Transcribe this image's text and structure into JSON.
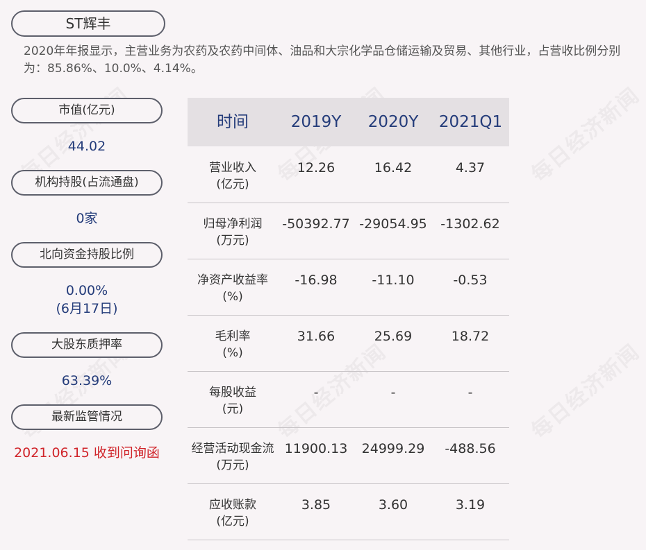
{
  "title": "ST辉丰",
  "summary": "2020年年报显示，主营业务为农药及农药中间体、油品和大宗化学品仓储运输及贸易、其他行业，占营收比例分别为：85.86%、10.0%、4.14%。",
  "side": [
    {
      "label": "市值(亿元)",
      "value": "44.02"
    },
    {
      "label": "机构持股(占流通盘)",
      "value": "0家"
    },
    {
      "label": "北向资金持股比例",
      "value": "0.00%",
      "value2": "(6月17日)"
    },
    {
      "label": "大股东质押率",
      "value": "63.39%"
    },
    {
      "label": "最新监管情况",
      "value": "2021.06.15 收到问询函"
    }
  ],
  "table": {
    "headers": [
      "时间",
      "2019Y",
      "2020Y",
      "2021Q1"
    ],
    "rows": [
      {
        "label": "营业收入",
        "unit": "(亿元)",
        "values": [
          "12.26",
          "16.42",
          "4.37"
        ]
      },
      {
        "label": "归母净利润",
        "unit": "(万元)",
        "values": [
          "-50392.77",
          "-29054.95",
          "-1302.62"
        ]
      },
      {
        "label": "净资产收益率",
        "unit": "(%)",
        "values": [
          "-16.98",
          "-11.10",
          "-0.53"
        ]
      },
      {
        "label": "毛利率",
        "unit": "(%)",
        "values": [
          "31.66",
          "25.69",
          "18.72"
        ]
      },
      {
        "label": "每股收益",
        "unit": "(元)",
        "values": [
          "-",
          "-",
          "-"
        ]
      },
      {
        "label": "经营活动现金流",
        "unit": "(万元)",
        "values": [
          "11900.13",
          "24999.29",
          "-488.56"
        ]
      },
      {
        "label": "应收账款",
        "unit": "(亿元)",
        "values": [
          "3.85",
          "3.60",
          "3.19"
        ]
      }
    ]
  },
  "watermark": "每日经济新闻",
  "colors": {
    "value_blue": "#243c7a",
    "alert_red": "#d0242a",
    "background": "#f8f4f6"
  }
}
